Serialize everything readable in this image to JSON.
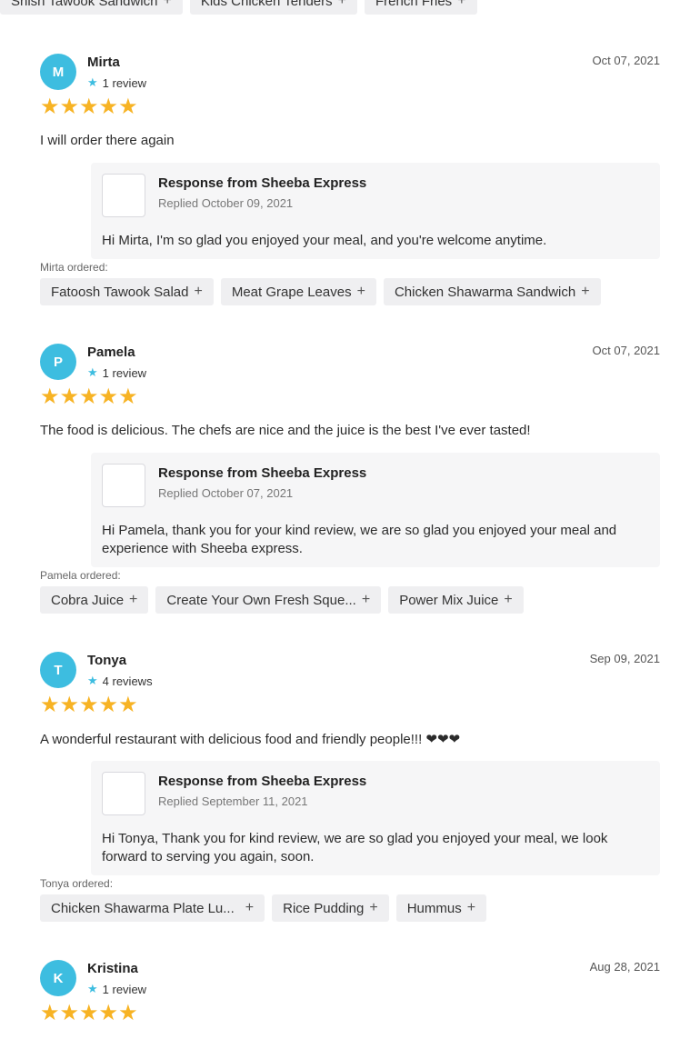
{
  "top_chips": [
    {
      "label": "Shish Tawook Sandwich"
    },
    {
      "label": "Kids Chicken Tenders"
    },
    {
      "label": "French Fries"
    }
  ],
  "colors": {
    "accent": "#3dbde0",
    "star": "#f7b324",
    "chip_bg": "#efeff1",
    "response_bg": "#f6f6f7"
  },
  "reviews": [
    {
      "initial": "M",
      "name": "Mirta",
      "review_count": "1 review",
      "date": "Oct 07, 2021",
      "rating": 5,
      "stars": "★★★★★",
      "text": "I will order there again",
      "response_title": "Response from Sheeba Express",
      "response_date": "Replied October 09, 2021",
      "response_text": "Hi Mirta, I'm so glad you enjoyed your meal, and you're welcome anytime.",
      "ordered_label": "Mirta ordered:",
      "ordered": [
        "Fatoosh Tawook Salad",
        "Meat Grape Leaves",
        "Chicken Shawarma Sandwich"
      ]
    },
    {
      "initial": "P",
      "name": "Pamela",
      "review_count": "1 review",
      "date": "Oct 07, 2021",
      "rating": 5,
      "stars": "★★★★★",
      "text": "The food is delicious. The chefs are nice and the juice is the best I've ever tasted!",
      "response_title": "Response from Sheeba Express",
      "response_date": "Replied October 07, 2021",
      "response_text": "Hi Pamela, thank you for your kind review, we are so glad you enjoyed your meal and experience with Sheeba express.",
      "ordered_label": "Pamela ordered:",
      "ordered": [
        "Cobra Juice",
        "Create Your Own Fresh Sque...",
        "Power Mix Juice"
      ]
    },
    {
      "initial": "T",
      "name": "Tonya",
      "review_count": "4 reviews",
      "date": "Sep 09, 2021",
      "rating": 5,
      "stars": "★★★★★",
      "text": "A wonderful restaurant with delicious food and friendly people!!! ❤❤❤",
      "response_title": "Response from Sheeba Express",
      "response_date": "Replied September 11, 2021",
      "response_text": "Hi Tonya, Thank you for kind review, we are so glad you enjoyed your meal, we look forward to serving you again, soon.",
      "ordered_label": "Tonya ordered:",
      "ordered": [
        "Chicken Shawarma Plate Lu...",
        "Rice Pudding",
        "Hummus"
      ]
    },
    {
      "initial": "K",
      "name": "Kristina",
      "review_count": "1 review",
      "date": "Aug 28, 2021",
      "rating": 5,
      "stars": "★★★★★"
    }
  ]
}
